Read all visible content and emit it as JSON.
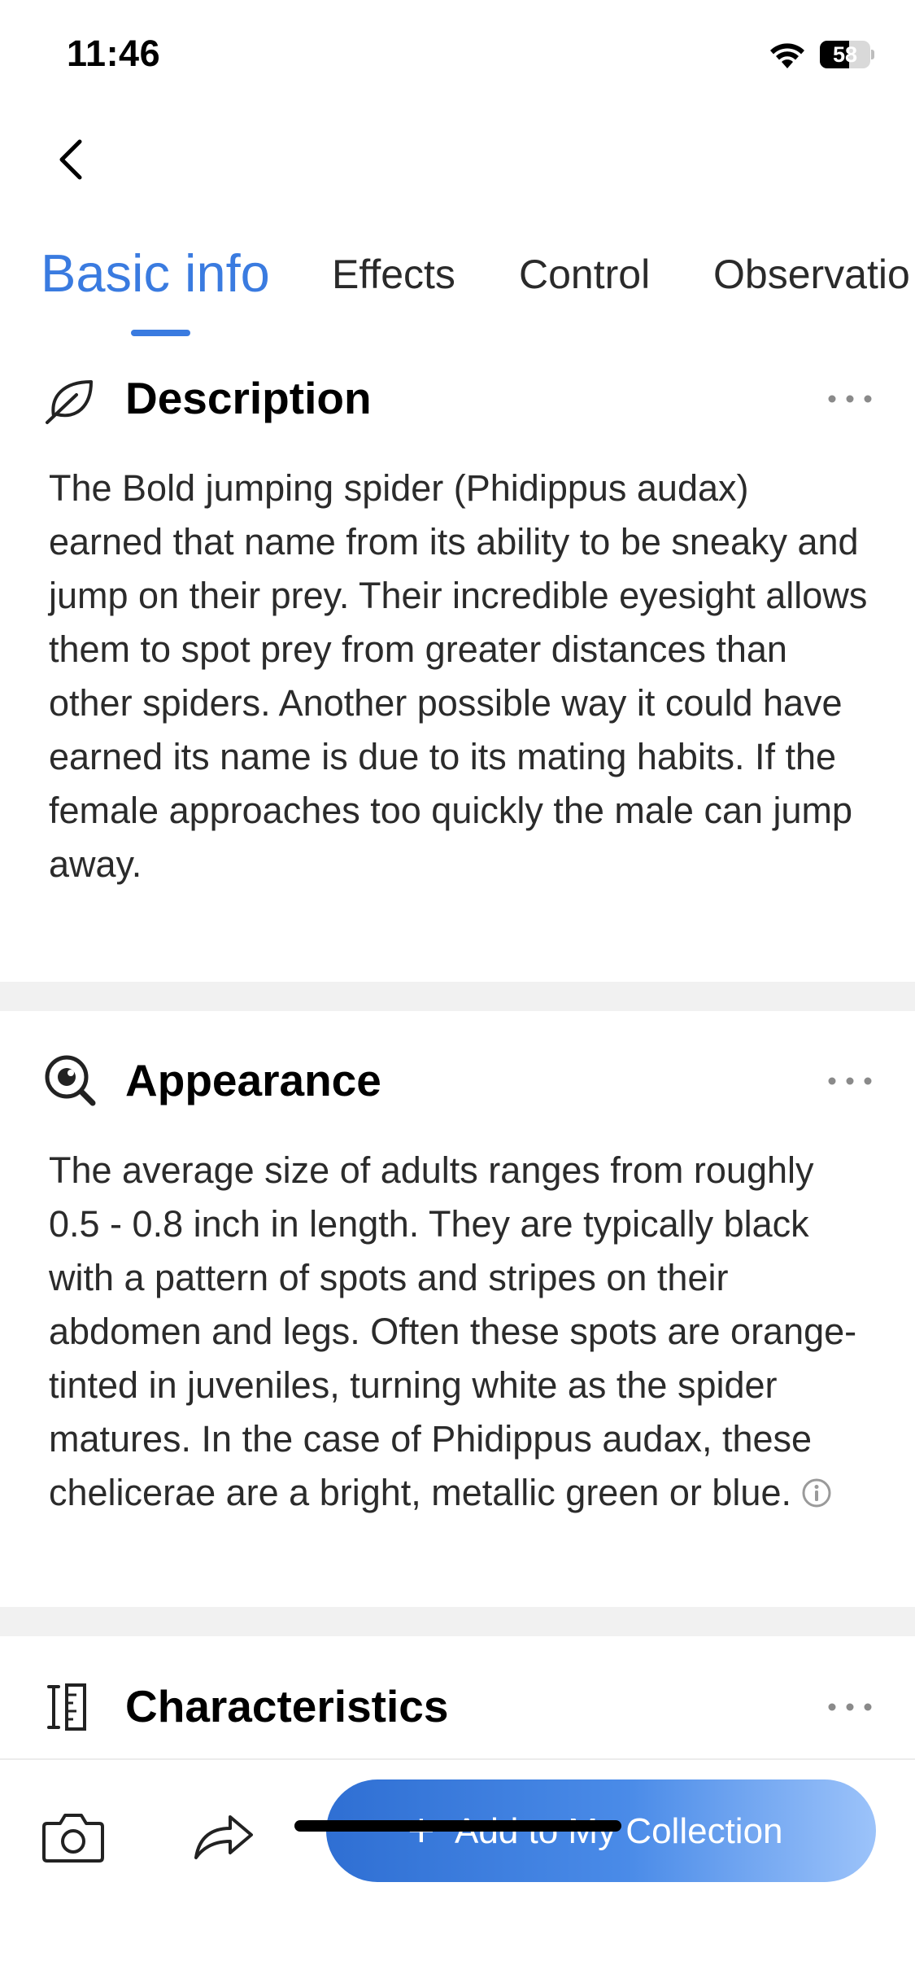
{
  "status_bar": {
    "time": "11:46",
    "battery_level": "58",
    "battery_fraction": 0.58
  },
  "navigation": {
    "back_icon": "chevron-left-icon"
  },
  "tabs": [
    {
      "label": "Basic info",
      "active": true
    },
    {
      "label": "Effects",
      "active": false
    },
    {
      "label": "Control",
      "active": false
    },
    {
      "label": "Observatio",
      "active": false
    }
  ],
  "sections": {
    "description": {
      "icon": "leaf-icon",
      "title": "Description",
      "body": "The Bold jumping spider (Phidippus audax) earned that name from its ability to be sneaky and jump on their prey. Their incredible eyesight allows them to spot prey from greater distances than other spiders. Another possible way it could have earned its name is due to its mating habits. If the female approaches too quickly the male can jump away."
    },
    "appearance": {
      "icon": "magnifier-eye-icon",
      "title": "Appearance",
      "body": "The average size of adults ranges from roughly 0.5 - 0.8 inch in length. They are typically black with a pattern of spots and stripes on their abdomen and legs. Often these spots are orange-tinted in juveniles, turning white as the spider matures. In the case of Phidippus audax, these chelicerae are a bright, metallic green or blue."
    },
    "characteristics": {
      "icon": "ruler-icon",
      "title": "Characteristics"
    }
  },
  "bottom_bar": {
    "camera_icon": "camera-icon",
    "share_icon": "share-arrow-icon",
    "add_plus": "+",
    "add_label": "Add to My Collection"
  },
  "colors": {
    "accent": "#3a7be0",
    "divider": "#f1f1f1",
    "body_text": "#2b2b2b"
  }
}
